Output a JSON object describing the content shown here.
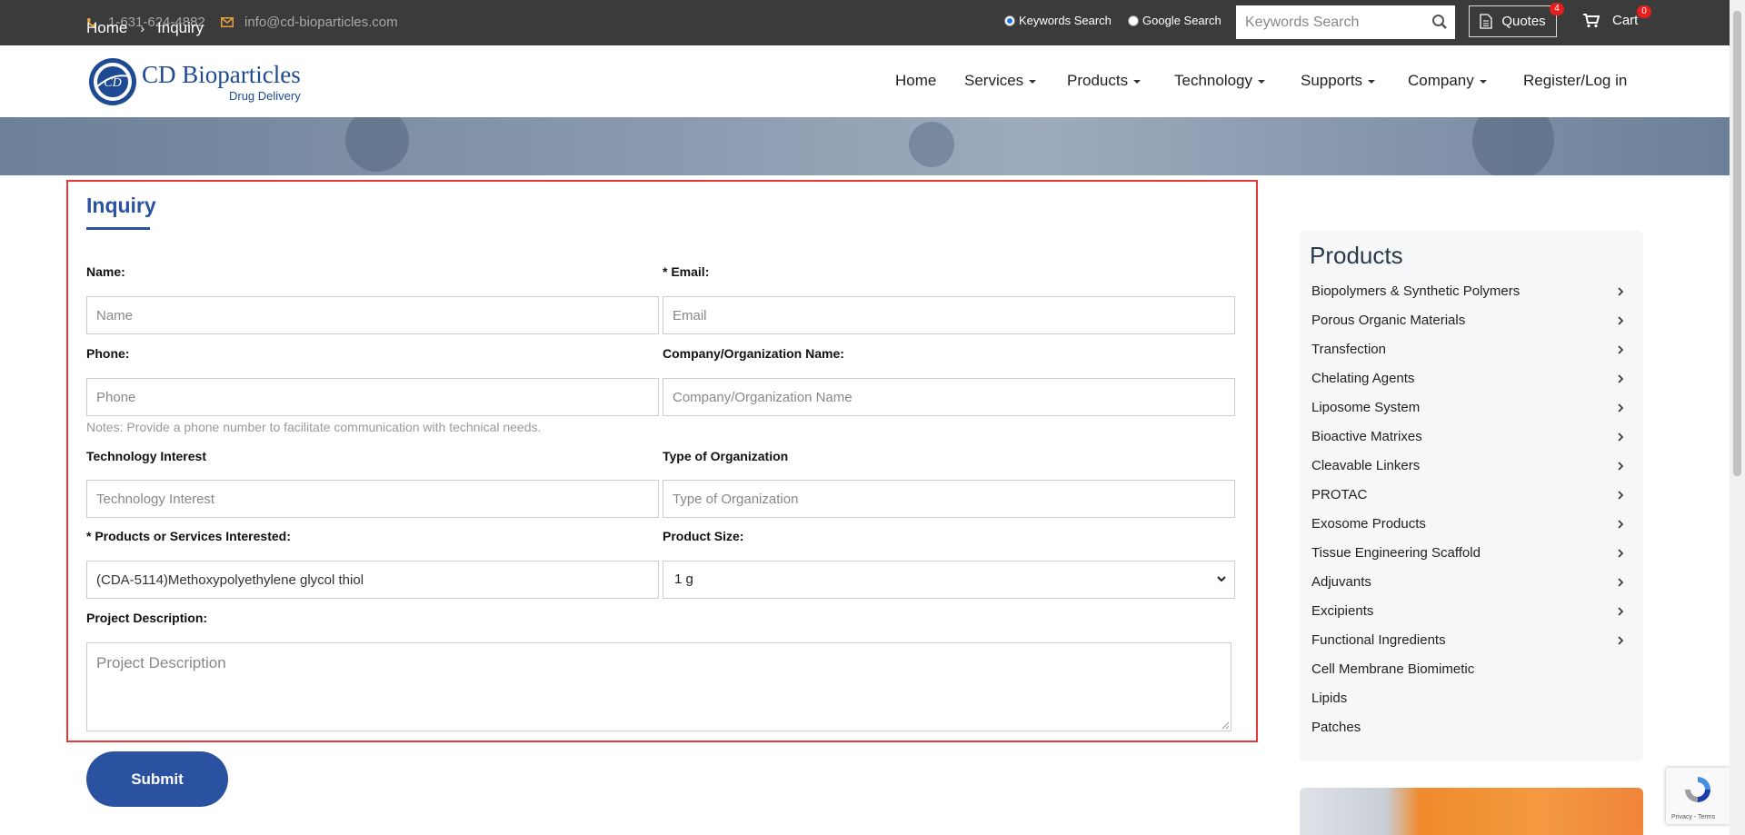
{
  "topbar": {
    "phone": "1-631-624-4882",
    "email": "info@cd-bioparticles.com",
    "radio_keywords": "Keywords Search",
    "radio_google": "Google Search",
    "search_placeholder": "Keywords Search",
    "quotes_label": "Quotes",
    "quotes_count": "4",
    "cart_label": "Cart",
    "cart_count": "0"
  },
  "header": {
    "brand": "CD Bioparticles",
    "sub": "Drug Delivery",
    "nav": [
      "Home",
      "Services",
      "Products",
      "Technology",
      "Supports",
      "Company",
      "Register/Log in"
    ]
  },
  "breadcrumb": {
    "home": "Home",
    "current": "Inquiry"
  },
  "form": {
    "title": "Inquiry",
    "name_label": "Name:",
    "name_placeholder": "Name",
    "email_label": "* Email:",
    "email_placeholder": "Email",
    "phone_label": "Phone:",
    "phone_placeholder": "Phone",
    "company_label": "Company/Organization Name:",
    "company_placeholder": "Company/Organization Name",
    "note": "Notes: Provide a phone number to facilitate communication with technical needs.",
    "tech_label": "Technology Interest",
    "tech_placeholder": "Technology Interest",
    "org_type_label": "Type of Organization",
    "org_type_placeholder": "Type of Organization",
    "products_label": "* Products or Services Interested:",
    "products_value": "(CDA-5114)Methoxypolyethylene glycol thiol",
    "size_label": "Product Size:",
    "size_value": "1 g",
    "desc_label": "Project Description:",
    "desc_placeholder": "Project Description",
    "submit": "Submit"
  },
  "sidebar": {
    "title": "Products",
    "items": [
      {
        "label": "Biopolymers & Synthetic Polymers",
        "arrow": true
      },
      {
        "label": "Porous Organic Materials",
        "arrow": true
      },
      {
        "label": "Transfection",
        "arrow": true
      },
      {
        "label": "Chelating Agents",
        "arrow": true
      },
      {
        "label": "Liposome System",
        "arrow": true
      },
      {
        "label": "Bioactive Matrixes",
        "arrow": true
      },
      {
        "label": "Cleavable Linkers",
        "arrow": true
      },
      {
        "label": "PROTAC",
        "arrow": true
      },
      {
        "label": "Exosome Products",
        "arrow": true
      },
      {
        "label": "Tissue Engineering Scaffold",
        "arrow": true
      },
      {
        "label": "Adjuvants",
        "arrow": true
      },
      {
        "label": "Excipients",
        "arrow": true
      },
      {
        "label": "Functional Ingredients",
        "arrow": true
      },
      {
        "label": "Cell Membrane Biomimetic",
        "arrow": false
      },
      {
        "label": "Lipids",
        "arrow": false
      },
      {
        "label": "Patches",
        "arrow": false
      }
    ]
  },
  "recaptcha": {
    "terms": "Privacy - Terms"
  },
  "colors": {
    "accent": "#2b52a0",
    "topbar": "#3b3b3b",
    "highlight_border": "#e53935",
    "icon_orange": "#e8a33c"
  }
}
